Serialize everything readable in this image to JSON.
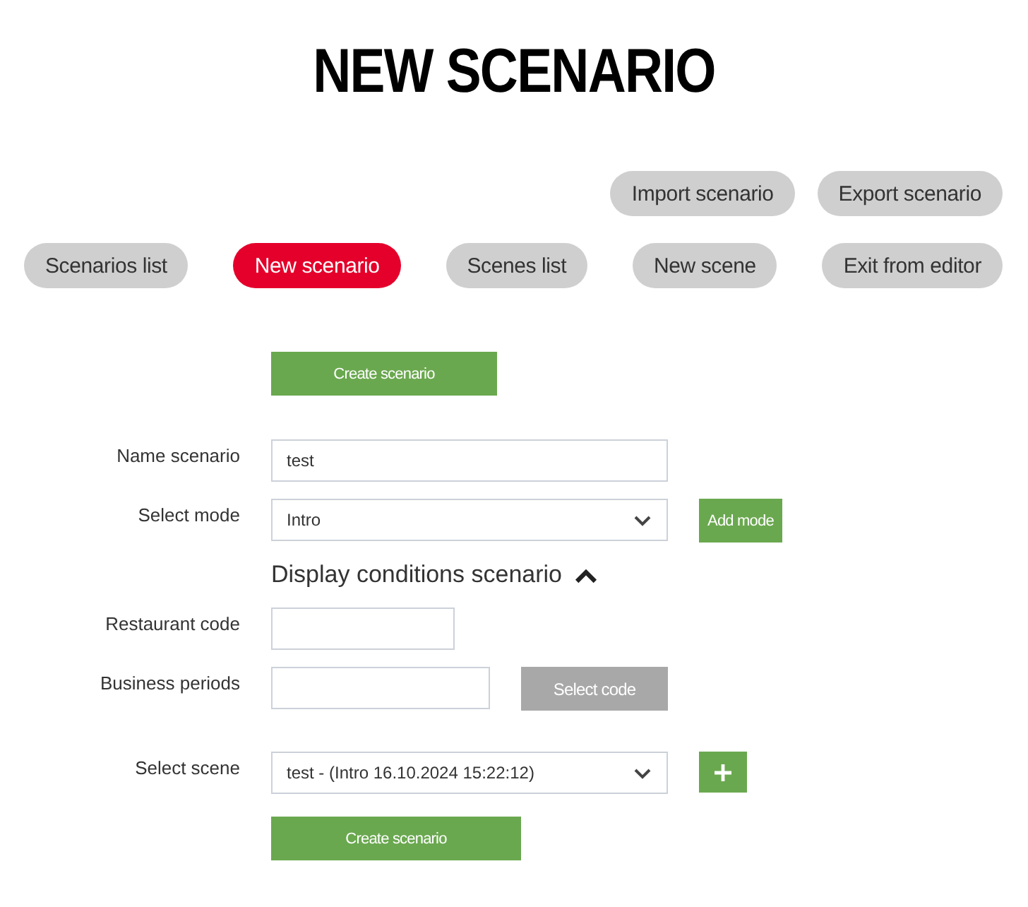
{
  "title": "NEW SCENARIO",
  "top_actions": [
    {
      "label": "Import scenario"
    },
    {
      "label": "Export scenario"
    }
  ],
  "nav": [
    {
      "label": "Scenarios list",
      "selected": false
    },
    {
      "label": "New scenario",
      "selected": true
    },
    {
      "label": "Scenes list",
      "selected": false
    },
    {
      "label": "New scene",
      "selected": false
    },
    {
      "label": "Exit from editor",
      "selected": false
    }
  ],
  "top_button": {
    "label": "Create scenario"
  },
  "fields": [
    {
      "label": "Name scenario",
      "kind": "input",
      "value": "test"
    },
    {
      "label": "Select mode",
      "kind": "select",
      "value": "Intro",
      "action": {
        "kind": "text",
        "label": "Add mode",
        "disabled": false
      }
    }
  ],
  "conditions": {
    "title": "Display conditions scenario",
    "expanded": true,
    "fields": [
      {
        "label": "Restaurant code",
        "kind": "input"
      },
      {
        "label": "Business periods",
        "kind": "input",
        "action": {
          "kind": "text",
          "label": "Select code",
          "disabled": true
        }
      }
    ]
  },
  "scene": {
    "label": "Select scene",
    "kind": "select",
    "value": "test - (Intro 16.10.2024 15:22:12)",
    "action": {
      "kind": "plus",
      "disabled": false
    }
  },
  "bottom_button": {
    "label": "Create scenario"
  }
}
